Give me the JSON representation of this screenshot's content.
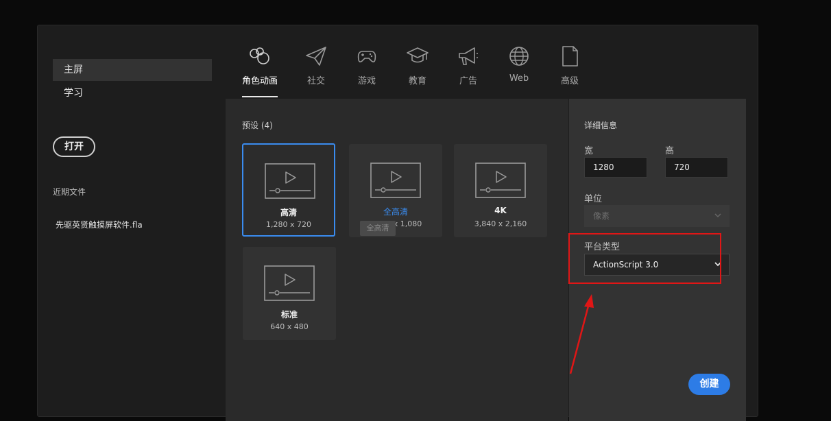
{
  "sidebar": {
    "nav": [
      {
        "label": "主屏",
        "active": true
      },
      {
        "label": "学习",
        "active": false
      }
    ],
    "open_label": "打开",
    "recent_heading": "近期文件",
    "recent_files": [
      "先驱英贤触摸屏软件.fla"
    ]
  },
  "categories": [
    {
      "label": "角色动画",
      "icon": "character-animation-icon",
      "active": true
    },
    {
      "label": "社交",
      "icon": "paper-plane-icon",
      "active": false
    },
    {
      "label": "游戏",
      "icon": "gamepad-icon",
      "active": false
    },
    {
      "label": "教育",
      "icon": "graduation-cap-icon",
      "active": false
    },
    {
      "label": "广告",
      "icon": "megaphone-icon",
      "active": false
    },
    {
      "label": "Web",
      "icon": "globe-icon",
      "active": false
    },
    {
      "label": "高级",
      "icon": "document-icon",
      "active": false
    }
  ],
  "presets": {
    "heading": "预设 (4)",
    "items": [
      {
        "name": "高清",
        "size": "1,280 x 720",
        "selected": true
      },
      {
        "name": "全高清",
        "size": "1,920 x 1,080",
        "selected": false,
        "hover": true
      },
      {
        "name": "4K",
        "size": "3,840 x 2,160",
        "selected": false
      },
      {
        "name": "标准",
        "size": "640 x 480",
        "selected": false
      }
    ],
    "tooltip": "全高清"
  },
  "details": {
    "heading": "详细信息",
    "width_label": "宽",
    "width_value": "1280",
    "height_label": "高",
    "height_value": "720",
    "unit_label": "单位",
    "unit_value": "像素",
    "platform_label": "平台类型",
    "platform_value": "ActionScript 3.0",
    "create_label": "创建"
  },
  "colors": {
    "accent": "#3a8cf0",
    "create_button": "#2d7ce6",
    "annotation": "#e01616"
  }
}
